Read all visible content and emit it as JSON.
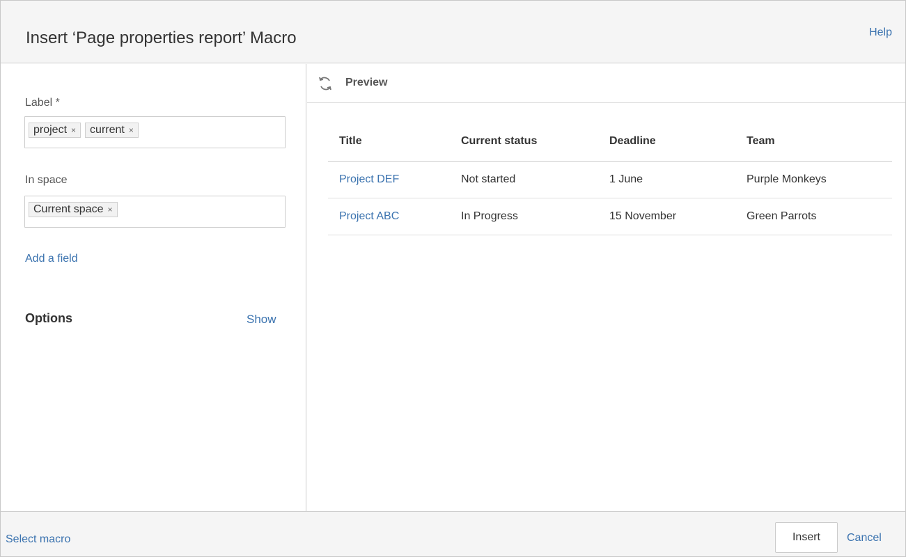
{
  "dialog": {
    "title": "Insert ‘Page properties report’ Macro",
    "help_label": "Help"
  },
  "form": {
    "label_field": {
      "label": "Label *",
      "chips": [
        "project",
        "current"
      ]
    },
    "space_field": {
      "label": "In space",
      "chips": [
        "Current space"
      ]
    },
    "chip_remove_glyph": "×",
    "add_field_label": "Add a field",
    "options_title": "Options",
    "options_toggle": "Show"
  },
  "preview": {
    "title": "Preview",
    "icon": "refresh-icon",
    "columns": [
      "Title",
      "Current status",
      "Deadline",
      "Team"
    ],
    "rows": [
      [
        "Project DEF",
        "Not started",
        "1 June",
        "Purple Monkeys"
      ],
      [
        "Project ABC",
        "In Progress",
        "15 November",
        "Green Parrots"
      ]
    ]
  },
  "footer": {
    "select_macro_label": "Select macro",
    "insert_label": "Insert",
    "cancel_label": "Cancel"
  },
  "colors": {
    "link": "#3b73af",
    "header_bg": "#f5f5f5",
    "border": "#cccccc"
  }
}
